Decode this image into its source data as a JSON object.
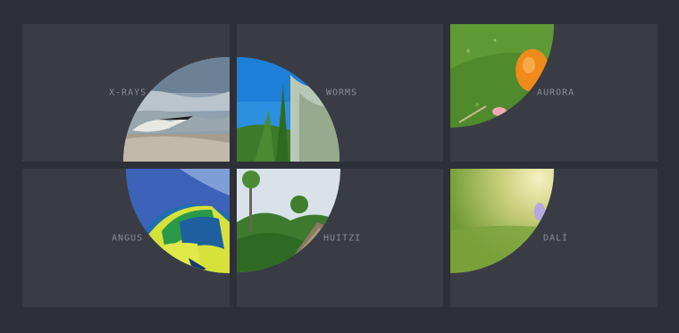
{
  "tiles": [
    {
      "id": "xrays",
      "label": "X-RAYS"
    },
    {
      "id": "worms",
      "label": "WORMS"
    },
    {
      "id": "aurora",
      "label": "AURORA"
    },
    {
      "id": "angus",
      "label": "ANGUS"
    },
    {
      "id": "huitzi",
      "label": "HUITZI"
    },
    {
      "id": "dali",
      "label": "DALÍ"
    }
  ],
  "colors": {
    "background": "#2e3038",
    "tile": "#3a3c45",
    "label": "#8b8d95"
  },
  "images": {
    "xrays": "seagull-on-surf",
    "worms": "blue-sky-grass-closeup",
    "aurora": "orange-fruit-on-grass",
    "angus": "hot-air-balloon",
    "huitzi": "tropical-trees-hut",
    "dali": "sunlit-meadow"
  }
}
